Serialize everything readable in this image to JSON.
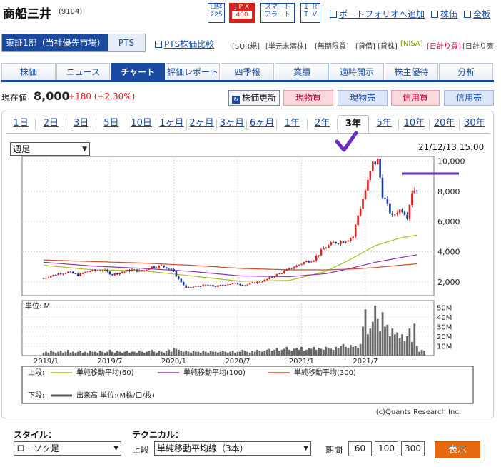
{
  "header": {
    "title": "商船三井",
    "code": "(9104)",
    "logos": {
      "nikkei": [
        "日経",
        "225"
      ],
      "jpx": [
        "J P X",
        "400"
      ],
      "smart": [
        "スマート",
        "アラート"
      ],
      "irtv": [
        "Ｉ Ｒ",
        "Ｔ Ｖ"
      ]
    },
    "links": {
      "portfolio": "ポートフォリオへ追加",
      "stock_price": "株価",
      "board": "全板",
      "pts_compare": "PTS株価比較"
    }
  },
  "market": {
    "primary": "東証1部（当社優先市場）",
    "pts": "PTS"
  },
  "tags": [
    "[SOR",
    "[単元未満株]",
    "[無期限買]",
    "[貸借]",
    "[貸株]",
    "[NISA]",
    "[日計り買]",
    "[日計り売"
  ],
  "tags_extra": {
    "sor_suffix": "規]"
  },
  "main_tabs": [
    "株価",
    "ニュース",
    "チャート",
    "評価レポート",
    "四季報",
    "業績",
    "適時開示",
    "株主優待",
    "分析"
  ],
  "price": {
    "label": "現在値",
    "value": "8,000",
    "change": "+180 (+2.30%)"
  },
  "actions": {
    "refresh": "株価更新",
    "buy_cash": "現物買",
    "sell_cash": "現物売",
    "buy_margin": "信用買",
    "sell_margin": "信用売"
  },
  "range_tabs": [
    "1日",
    "2日",
    "3日",
    "5日",
    "10日",
    "1ヶ月",
    "2ヶ月",
    "3ヶ月",
    "6ヶ月",
    "1年",
    "2年",
    "3年",
    "5年",
    "10年",
    "20年",
    "30年"
  ],
  "range_active_index": 11,
  "period_select": "週足",
  "timestamp": "21/12/13 15:00",
  "chart_data": {
    "type": "candlestick",
    "price_axis": {
      "ticks": [
        2000,
        4000,
        6000,
        8000,
        10000
      ],
      "tick_labels": [
        "2,000",
        "4,000",
        "6,000",
        "8,000",
        "10,000"
      ],
      "ylim": [
        1100,
        10300
      ]
    },
    "volume_axis": {
      "unit_label": "単位: M",
      "ticks": [
        10,
        20,
        30,
        40,
        50
      ],
      "tick_labels": [
        "10M",
        "20M",
        "30M",
        "40M",
        "50M"
      ],
      "ylim": [
        0,
        57
      ]
    },
    "x_labels": [
      "2019/1",
      "2019/7",
      "2020/1",
      "2020/7",
      "2021/1",
      "2021/7"
    ],
    "x_label_weeks": [
      1,
      27,
      53,
      79,
      105,
      131
    ],
    "total_weeks": 156,
    "close_path": [
      [
        0,
        2250
      ],
      [
        6,
        2550
      ],
      [
        10,
        2650
      ],
      [
        14,
        2450
      ],
      [
        18,
        2700
      ],
      [
        24,
        2800
      ],
      [
        28,
        2500
      ],
      [
        32,
        2650
      ],
      [
        36,
        2800
      ],
      [
        40,
        2700
      ],
      [
        44,
        3000
      ],
      [
        48,
        3050
      ],
      [
        52,
        2850
      ],
      [
        55,
        2200
      ],
      [
        58,
        1600
      ],
      [
        62,
        1700
      ],
      [
        66,
        1800
      ],
      [
        70,
        1700
      ],
      [
        74,
        1850
      ],
      [
        78,
        1900
      ],
      [
        82,
        1800
      ],
      [
        86,
        1950
      ],
      [
        90,
        2100
      ],
      [
        94,
        2400
      ],
      [
        98,
        2700
      ],
      [
        102,
        3000
      ],
      [
        106,
        3300
      ],
      [
        110,
        3500
      ],
      [
        114,
        4200
      ],
      [
        118,
        4600
      ],
      [
        122,
        4700
      ],
      [
        126,
        5000
      ],
      [
        128,
        6400
      ],
      [
        130,
        7500
      ],
      [
        132,
        8600
      ],
      [
        134,
        9800
      ],
      [
        136,
        10000
      ],
      [
        138,
        7800
      ],
      [
        140,
        7000
      ],
      [
        142,
        6300
      ],
      [
        144,
        6700
      ],
      [
        146,
        6800
      ],
      [
        148,
        6400
      ],
      [
        150,
        8000
      ],
      [
        152,
        8200
      ]
    ],
    "ma_lines": [
      {
        "name": "単純移動平均(60)",
        "color": "#a8c020",
        "points": [
          [
            0,
            3100
          ],
          [
            20,
            2800
          ],
          [
            40,
            2750
          ],
          [
            60,
            2400
          ],
          [
            80,
            2050
          ],
          [
            100,
            2100
          ],
          [
            115,
            2700
          ],
          [
            125,
            3500
          ],
          [
            135,
            4400
          ],
          [
            145,
            4900
          ],
          [
            152,
            5100
          ]
        ]
      },
      {
        "name": "単純移動平均(100)",
        "color": "#9030b0",
        "points": [
          [
            0,
            3300
          ],
          [
            20,
            3050
          ],
          [
            40,
            2900
          ],
          [
            60,
            2700
          ],
          [
            80,
            2400
          ],
          [
            100,
            2350
          ],
          [
            115,
            2550
          ],
          [
            125,
            2900
          ],
          [
            135,
            3300
          ],
          [
            145,
            3600
          ],
          [
            152,
            3800
          ]
        ]
      },
      {
        "name": "単純移動平均(300)",
        "color": "#d04a20",
        "points": [
          [
            0,
            3450
          ],
          [
            20,
            3350
          ],
          [
            40,
            3250
          ],
          [
            60,
            3100
          ],
          [
            80,
            2900
          ],
          [
            100,
            2800
          ],
          [
            115,
            2800
          ],
          [
            125,
            2850
          ],
          [
            135,
            2950
          ],
          [
            145,
            3100
          ],
          [
            152,
            3200
          ]
        ]
      }
    ],
    "volume": [
      3,
      4,
      3,
      5,
      4,
      3,
      4,
      5,
      3,
      4,
      6,
      3,
      4,
      3,
      4,
      5,
      3,
      4,
      3,
      5,
      4,
      4,
      3,
      5,
      4,
      3,
      4,
      6,
      4,
      3,
      5,
      4,
      3,
      4,
      5,
      3,
      4,
      4,
      3,
      5,
      4,
      3,
      4,
      5,
      6,
      4,
      3,
      5,
      4,
      3,
      5,
      6,
      4,
      8,
      7,
      6,
      5,
      4,
      5,
      4,
      3,
      5,
      4,
      4,
      3,
      5,
      4,
      3,
      5,
      4,
      4,
      3,
      4,
      5,
      4,
      3,
      4,
      5,
      3,
      4,
      4,
      6,
      5,
      4,
      3,
      5,
      4,
      6,
      5,
      4,
      5,
      6,
      7,
      5,
      6,
      8,
      5,
      6,
      7,
      9,
      6,
      5,
      7,
      8,
      6,
      9,
      5,
      6,
      8,
      7,
      9,
      6,
      8,
      7,
      6,
      9,
      8,
      7,
      6,
      9,
      8,
      10,
      12,
      9,
      8,
      11,
      9,
      10,
      8,
      12,
      30,
      48,
      22,
      28,
      35,
      52,
      38,
      25,
      45,
      30,
      32,
      20,
      28,
      22,
      24,
      18,
      22,
      15,
      20,
      28,
      14,
      33,
      10,
      4,
      6,
      5
    ],
    "legend": {
      "upper_label": "上段:",
      "lower_label": "下段:",
      "lower_series": "出来高 単位:(M株/口/枚)"
    },
    "credit": "(c)Quants Research Inc."
  },
  "annotation": {
    "checkmark_color": "#6a2ac0",
    "hline_color": "#6a2ac0"
  },
  "bottom": {
    "style_label": "スタイル：",
    "style_value": "ローソク足",
    "tech_label": "テクニカル：",
    "upper_label": "上段",
    "ma_value": "単純移動平均線（3本）",
    "period_label": "期間",
    "periods": [
      "60",
      "100",
      "300"
    ],
    "show_button": "表示"
  }
}
